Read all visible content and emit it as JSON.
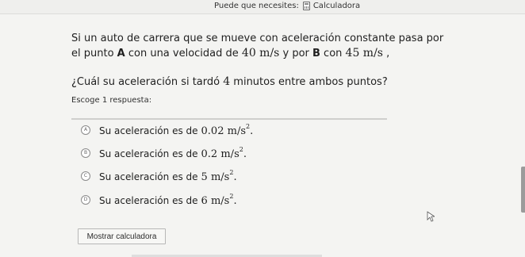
{
  "toolbar": {
    "label": "Puede que necesites:",
    "calculator": "Calculadora"
  },
  "question": {
    "intro": "Si un auto de carrera que se mueve con aceleración constante pasa por el punto ",
    "point_a": "A",
    "middle": " con una velocidad de ",
    "speed_a": "40 m/s",
    "and_by": " y por ",
    "point_b": "B",
    "with": " con ",
    "speed_b": "45 m/s",
    "end": " ,",
    "ask_start": "¿Cuál su aceleración si tardó ",
    "minutes": "4",
    "ask_end": " minutos entre ambos puntos?"
  },
  "choose_label": "Escoge 1 respuesta:",
  "options": [
    {
      "letter": "A",
      "text": "Su aceleración es de",
      "value": "0.02",
      "unit": "m/s",
      "power": "2",
      "punct": "."
    },
    {
      "letter": "B",
      "text": "Su aceleración es de",
      "value": "0.2",
      "unit": "m/s",
      "power": "2",
      "punct": "."
    },
    {
      "letter": "C",
      "text": "Su aceleración es de",
      "value": "5",
      "unit": "m/s",
      "power": "2",
      "punct": "."
    },
    {
      "letter": "D",
      "text": "Su aceleración es de",
      "value": "6",
      "unit": "m/s",
      "power": "2",
      "punct": "."
    }
  ],
  "show_calculator": "Mostrar calculadora"
}
